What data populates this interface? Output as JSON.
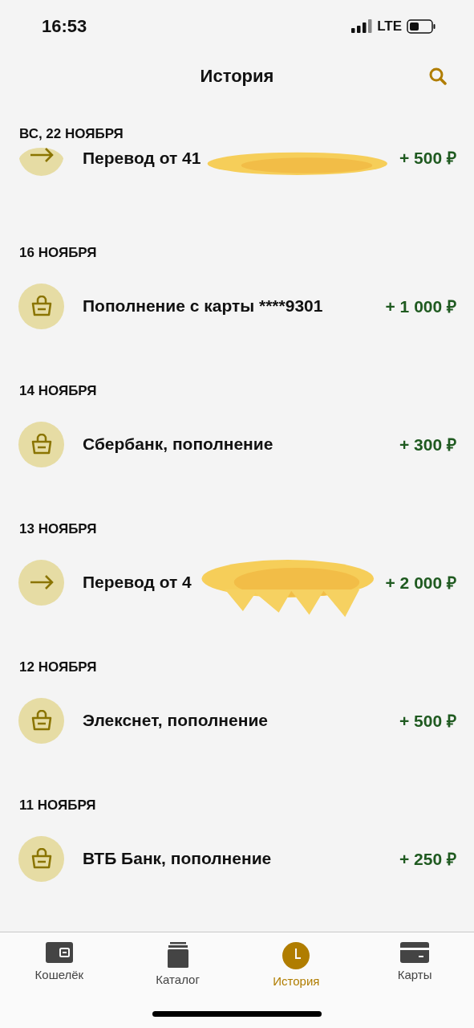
{
  "status_bar": {
    "time": "16:53",
    "network": "LTE"
  },
  "header": {
    "title": "История"
  },
  "groups": [
    {
      "date": "ВС, 22 НОЯБРЯ",
      "items": [
        {
          "kind": "arrow",
          "name": "Перевод от 41",
          "amount": "+ 500 ₽",
          "redacted": true
        }
      ]
    },
    {
      "date": "16 НОЯБРЯ",
      "items": [
        {
          "kind": "basket",
          "name": "Пополнение с карты ****9301",
          "amount": "+ 1 000 ₽",
          "redacted": false
        }
      ]
    },
    {
      "date": "14 НОЯБРЯ",
      "items": [
        {
          "kind": "basket",
          "name": "Сбербанк, пополнение",
          "amount": "+ 300 ₽",
          "redacted": false
        }
      ]
    },
    {
      "date": "13 НОЯБРЯ",
      "items": [
        {
          "kind": "arrow",
          "name": "Перевод от 4",
          "amount": "+ 2 000 ₽",
          "redacted": true
        }
      ]
    },
    {
      "date": "12 НОЯБРЯ",
      "items": [
        {
          "kind": "basket",
          "name": "Элекснет, пополнение",
          "amount": "+ 500 ₽",
          "redacted": false
        }
      ]
    },
    {
      "date": "11 НОЯБРЯ",
      "items": [
        {
          "kind": "basket",
          "name": "ВТБ Банк, пополнение",
          "amount": "+ 250 ₽",
          "redacted": false
        }
      ]
    }
  ],
  "tabs": [
    {
      "kind": "wallet",
      "label": "Кошелёк",
      "selected": false
    },
    {
      "kind": "catalog",
      "label": "Каталог",
      "selected": false
    },
    {
      "kind": "clock",
      "label": "История",
      "selected": true
    },
    {
      "kind": "card",
      "label": "Карты",
      "selected": false
    }
  ]
}
